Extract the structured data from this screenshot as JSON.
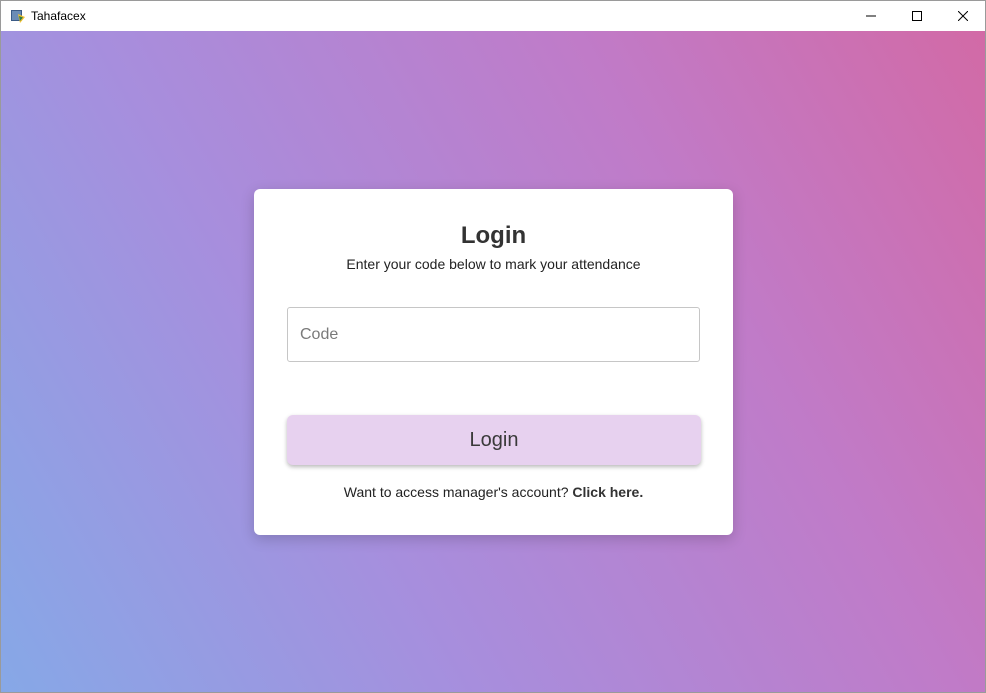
{
  "window": {
    "title": "Tahafacex",
    "app_icon": "python-feather-icon",
    "controls": {
      "minimize_icon": "minimize-icon",
      "maximize_icon": "maximize-icon",
      "close_icon": "close-icon"
    }
  },
  "background": {
    "gradient_colors": [
      "#86a8e7",
      "#a78edd",
      "#c07bc8",
      "#d26aa6"
    ]
  },
  "login_card": {
    "title": "Login",
    "subtitle": "Enter your code below to mark your attendance",
    "code_input": {
      "placeholder": "Code",
      "value": ""
    },
    "login_button_label": "Login",
    "login_button_color": "#e7d1ef",
    "manager_prompt": "Want to access manager's account?",
    "manager_link": "Click here."
  }
}
